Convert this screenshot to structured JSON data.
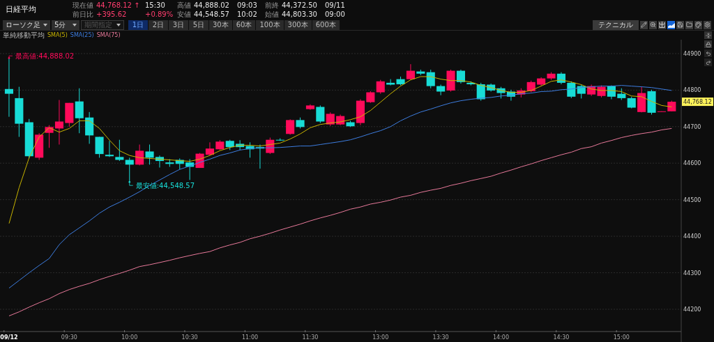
{
  "title": "日経平均",
  "quotes": [
    {
      "label": "現在値",
      "value": "44,768.12",
      "marker": "↑",
      "extra": "15:30",
      "color": "#ff3d6e"
    },
    {
      "label": "高値",
      "value": "44,888.02",
      "extra": "09:03",
      "color": "#e6e6e6"
    },
    {
      "label": "前終",
      "value": "44,372.50",
      "extra": "09/11",
      "color": "#e6e6e6"
    },
    {
      "label": "前日比",
      "value": "+395.62",
      "extra": "+0.89%",
      "color": "#ff3d6e"
    },
    {
      "label": "安値",
      "value": "44,548.57",
      "extra": "10:02",
      "color": "#e6e6e6"
    },
    {
      "label": "始値",
      "value": "44,803.30",
      "extra": "09:00",
      "color": "#e6e6e6"
    }
  ],
  "toolbar": {
    "dropdowns": [
      {
        "label": "ローソク足",
        "disabled": false
      },
      {
        "label": "5分",
        "disabled": false
      },
      {
        "label": "期間指定",
        "disabled": true
      }
    ],
    "periods": [
      {
        "label": "1日",
        "selected": true
      },
      {
        "label": "2日",
        "selected": false
      },
      {
        "label": "3日",
        "selected": false
      },
      {
        "label": "5日",
        "selected": false
      },
      {
        "label": "30本",
        "selected": false
      },
      {
        "label": "60本",
        "selected": false
      },
      {
        "label": "100本",
        "selected": false
      },
      {
        "label": "300本",
        "selected": false
      },
      {
        "label": "600本",
        "selected": false
      }
    ],
    "technical_button": "テクニカル",
    "tools": [
      {
        "kind": "pencil",
        "selected": false
      },
      {
        "kind": "zoom",
        "selected": false
      },
      {
        "kind": "compare",
        "selected": false
      },
      {
        "kind": "area",
        "selected": true
      },
      {
        "kind": "save",
        "selected": false
      },
      {
        "kind": "folder",
        "selected": false
      },
      {
        "kind": "palette",
        "selected": false
      },
      {
        "kind": "settings",
        "selected": false
      }
    ]
  },
  "legend": {
    "title": "単純移動平均"
  },
  "chart": {
    "chart_data": {
      "type": "candlestick",
      "grid": true,
      "categories": [
        "09/12",
        null,
        null,
        null,
        null,
        null,
        "09:30",
        null,
        null,
        null,
        null,
        null,
        "10:00",
        null,
        null,
        null,
        null,
        null,
        "10:30",
        null,
        null,
        null,
        null,
        null,
        "11:00",
        null,
        null,
        null,
        null,
        null,
        "11:30",
        null,
        null,
        null,
        null,
        null,
        null,
        "13:00",
        null,
        null,
        null,
        null,
        null,
        "13:30",
        null,
        null,
        null,
        null,
        null,
        "14:00",
        null,
        null,
        null,
        null,
        null,
        "14:30",
        null,
        null,
        null,
        null,
        null,
        "15:00",
        null,
        null,
        null,
        null,
        null
      ],
      "ylim": [
        44139,
        44938
      ],
      "yticks": [
        44200,
        44300,
        44400,
        44500,
        44600,
        44700,
        44800,
        44900
      ],
      "ohlc": [
        [
          44803,
          44888.02,
          44727,
          44790
        ],
        [
          44778,
          44809,
          44672,
          44708
        ],
        [
          44712,
          44721,
          44613,
          44619
        ],
        [
          44615,
          44682,
          44609,
          44678
        ],
        [
          44683,
          44704,
          44642,
          44699
        ],
        [
          44695,
          44773,
          44651,
          44714
        ],
        [
          44710,
          44765,
          44700,
          44765
        ],
        [
          44769,
          44805,
          44682,
          44723
        ],
        [
          44725,
          44740,
          44653,
          44676
        ],
        [
          44672,
          44672,
          44615,
          44625
        ],
        [
          44623,
          44661,
          44617,
          44619
        ],
        [
          44617,
          44664,
          44606,
          44609
        ],
        [
          44609,
          44615,
          44548.57,
          44596
        ],
        [
          44596,
          44651,
          44594,
          44634
        ],
        [
          44632,
          44651,
          44596,
          44615
        ],
        [
          44617,
          44621,
          44588,
          44606
        ],
        [
          44602,
          44611,
          44590,
          44598
        ],
        [
          44609,
          44613,
          44583,
          44598
        ],
        [
          44602,
          44611,
          44554,
          44590
        ],
        [
          44587,
          44628,
          44587,
          44626
        ],
        [
          44623,
          44657,
          44621,
          44640
        ],
        [
          44638,
          44663,
          44636,
          44659
        ],
        [
          44661,
          44664,
          44636,
          44644
        ],
        [
          44653,
          44663,
          44636,
          44644
        ],
        [
          44647,
          44657,
          44615,
          44638
        ],
        [
          44644,
          44651,
          44585,
          44640
        ],
        [
          44628,
          44670,
          44625,
          44664
        ],
        [
          44664,
          44668,
          44661,
          44662
        ],
        [
          44680,
          44720,
          44678,
          44718
        ],
        [
          44718,
          44725,
          44695,
          44699
        ],
        [
          44748,
          44761,
          44746,
          44758
        ],
        [
          44754,
          44758,
          44710,
          44714
        ],
        [
          44706,
          44739,
          44702,
          44735
        ],
        [
          44706,
          44733,
          44704,
          44729
        ],
        [
          44712,
          44716,
          44699,
          44701
        ],
        [
          44710,
          44775,
          44704,
          44771
        ],
        [
          44767,
          44797,
          44765,
          44794
        ],
        [
          44794,
          44828,
          44790,
          44824
        ],
        [
          44820,
          44830,
          44813,
          44815
        ],
        [
          44830,
          44837,
          44813,
          44816
        ],
        [
          44830,
          44871,
          44828,
          44853
        ],
        [
          44851,
          44856,
          44841,
          44845
        ],
        [
          44849,
          44856,
          44805,
          44811
        ],
        [
          44811,
          44815,
          44786,
          44796
        ],
        [
          44799,
          44856,
          44796,
          44853
        ],
        [
          44853,
          44856,
          44818,
          44822
        ],
        [
          44820,
          44824,
          44813,
          44816
        ],
        [
          44816,
          44820,
          44771,
          44775
        ],
        [
          44815,
          44818,
          44796,
          44799
        ],
        [
          44805,
          44809,
          44777,
          44792
        ],
        [
          44796,
          44801,
          44771,
          44782
        ],
        [
          44788,
          44805,
          44780,
          44799
        ],
        [
          44797,
          44826,
          44794,
          44822
        ],
        [
          44815,
          44835,
          44811,
          44832
        ],
        [
          44832,
          44849,
          44828,
          44845
        ],
        [
          44845,
          44849,
          44816,
          44820
        ],
        [
          44820,
          44824,
          44778,
          44782
        ],
        [
          44811,
          44815,
          44777,
          44790
        ],
        [
          44788,
          44815,
          44784,
          44811
        ],
        [
          44784,
          44813,
          44780,
          44809
        ],
        [
          44811,
          44813,
          44775,
          44782
        ],
        [
          44790,
          44805,
          44773,
          44778
        ],
        [
          44778,
          44782,
          44750,
          44752
        ],
        [
          44740,
          44809,
          44739,
          44792
        ],
        [
          44797,
          44801,
          44733,
          44738
        ],
        [
          44741,
          44742,
          44741,
          44742
        ],
        [
          44742,
          44771,
          44742,
          44768.12
        ]
      ],
      "series": [
        {
          "name": "SMA(5)",
          "type": "line",
          "color": "#c8b400",
          "values": [
            44435,
            44533,
            44615,
            44672,
            44697,
            44685,
            44695,
            44716,
            44716,
            44695,
            44663,
            44634,
            44621,
            44615,
            44613,
            44611,
            44609,
            44607,
            44605,
            44611,
            44621,
            44634,
            44643,
            44649,
            44649,
            44647,
            44651,
            44655,
            44666,
            44680,
            44697,
            44706,
            44710,
            44713,
            44719,
            44727,
            44744,
            44767,
            44790,
            44811,
            44828,
            44837,
            44837,
            44830,
            44826,
            44826,
            44822,
            44813,
            44807,
            44799,
            44794,
            44794,
            44799,
            44811,
            44824,
            44828,
            44822,
            44815,
            44803,
            44799,
            44799,
            44796,
            44784,
            44782,
            44769,
            44758,
            44754
          ]
        },
        {
          "name": "SMA(25)",
          "type": "line",
          "color": "#3d7de0",
          "values": [
            44258,
            44279,
            44300,
            44320,
            44339,
            44377,
            44404,
            44423,
            44442,
            44463,
            44480,
            44493,
            44507,
            44522,
            44539,
            44554,
            44569,
            44583,
            44592,
            44602,
            44611,
            44621,
            44628,
            44636,
            44640,
            44642,
            44642,
            44643,
            44645,
            44647,
            44647,
            44651,
            44655,
            44659,
            44664,
            44672,
            44681,
            44689,
            44700,
            44716,
            44729,
            44740,
            44748,
            44757,
            44765,
            44771,
            44775,
            44778,
            44780,
            44784,
            44786,
            44790,
            44792,
            44796,
            44797,
            44801,
            44803,
            44807,
            44809,
            44811,
            44811,
            44813,
            44811,
            44809,
            44807,
            44803,
            44799
          ]
        },
        {
          "name": "SMA(75)",
          "type": "line",
          "color": "#e8799a",
          "values": [
            44182,
            44193,
            44206,
            44218,
            44229,
            44243,
            44254,
            44263,
            44271,
            44281,
            44290,
            44298,
            44307,
            44317,
            44322,
            44328,
            44334,
            44341,
            44347,
            44353,
            44358,
            44368,
            44376,
            44383,
            44393,
            44400,
            44408,
            44417,
            44425,
            44433,
            44442,
            44450,
            44457,
            44465,
            44474,
            44480,
            44488,
            44493,
            44499,
            44507,
            44512,
            44520,
            44526,
            44531,
            44539,
            44545,
            44552,
            44558,
            44564,
            44573,
            44581,
            44590,
            44598,
            44607,
            44615,
            44623,
            44630,
            44640,
            44645,
            44655,
            44662,
            44670,
            44676,
            44681,
            44685,
            44691,
            44695
          ]
        }
      ],
      "annotations": [
        "最高値:44,888.02",
        "最安値:44,548.57",
        "44,768.12"
      ]
    }
  }
}
